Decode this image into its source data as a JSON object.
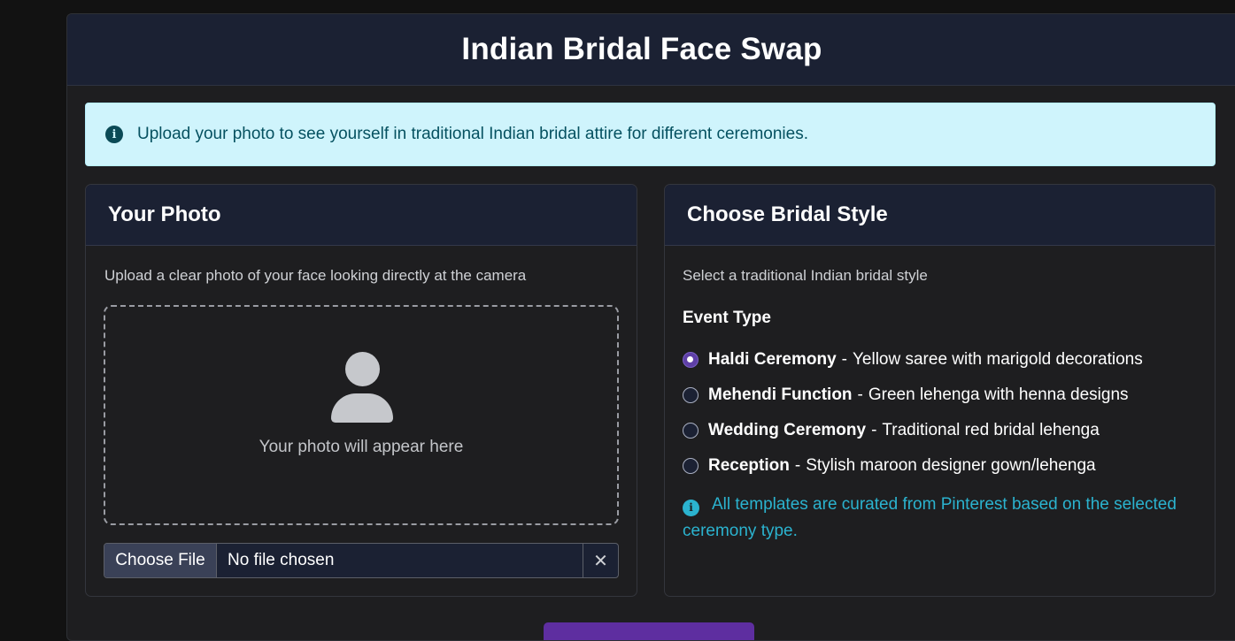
{
  "app": {
    "title": "Indian Bridal Face Swap"
  },
  "alert": {
    "icon": "info-circle-icon",
    "text": "Upload your photo to see yourself in traditional Indian bridal attire for different ceremonies."
  },
  "photo_panel": {
    "title": "Your Photo",
    "description": "Upload a clear photo of your face looking directly at the camera",
    "placeholder_icon": "person-icon",
    "placeholder_text": "Your photo will appear here",
    "file_input": {
      "button_label": "Choose File",
      "status": "No file chosen",
      "clear_icon": "close-icon",
      "clear_glyph": "✕"
    }
  },
  "style_panel": {
    "title": "Choose Bridal Style",
    "description": "Select a traditional Indian bridal style",
    "event_type_label": "Event Type",
    "options": [
      {
        "name": "Haldi Ceremony",
        "separator": "-",
        "detail": "Yellow saree with marigold decorations",
        "checked": true
      },
      {
        "name": "Mehendi Function",
        "separator": "-",
        "detail": "Green lehenga with henna designs",
        "checked": false
      },
      {
        "name": "Wedding Ceremony",
        "separator": "-",
        "detail": "Traditional red bridal lehenga",
        "checked": false
      },
      {
        "name": "Reception",
        "separator": "-",
        "detail": "Stylish maroon designer gown/lehenga",
        "checked": false
      }
    ],
    "note": {
      "icon": "info-circle-icon",
      "text": "All templates are curated from Pinterest based on the selected ceremony type."
    }
  },
  "colors": {
    "page_background": "#121212",
    "header_background": "#1b2133",
    "alert_background": "#cff4fc",
    "accent_purple": "#5e3fa6",
    "info_text": "#2bb3cf"
  }
}
